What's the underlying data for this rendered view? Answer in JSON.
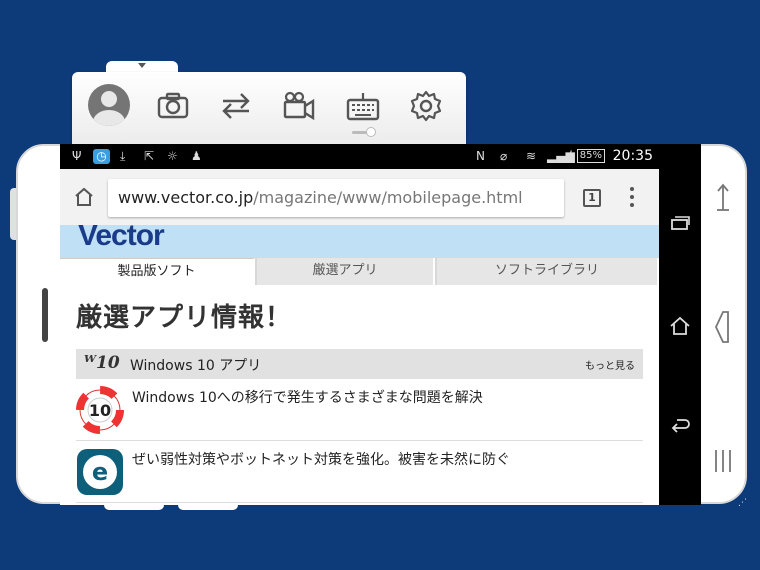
{
  "toolbar": {
    "icons": [
      "avatar",
      "camera-icon",
      "swap-arrows-icon",
      "video-camera-icon",
      "keyboard-icon",
      "gear-icon"
    ]
  },
  "status_bar": {
    "battery": "85%",
    "time": "20:35"
  },
  "browser": {
    "url_host": "www.vector.co.jp",
    "url_path": "/magazine/www/mobilepage.html",
    "tab_count": "1"
  },
  "page": {
    "logo": "Vector",
    "tabs": [
      {
        "label": "製品版ソフト",
        "active": true
      },
      {
        "label": "厳選アプリ",
        "active": false
      },
      {
        "label": "ソフトライブラリ",
        "active": false
      }
    ],
    "title": "厳選アプリ情報！",
    "section": {
      "badge": "10",
      "title": "Windows 10 アプリ",
      "more": "もっと見る"
    },
    "articles": [
      {
        "text": "Windows 10への移行で発生するさまざまな問題を解決",
        "icon": "lifebuoy-10-icon"
      },
      {
        "text": "ぜい弱性対策やボットネット対策を強化。被害を未然に防ぐ",
        "icon": "eset-icon"
      }
    ]
  },
  "colors": {
    "background": "#0d3a78",
    "logo_strip": "#bfe0f5",
    "logo_text": "#1a3a8a"
  }
}
